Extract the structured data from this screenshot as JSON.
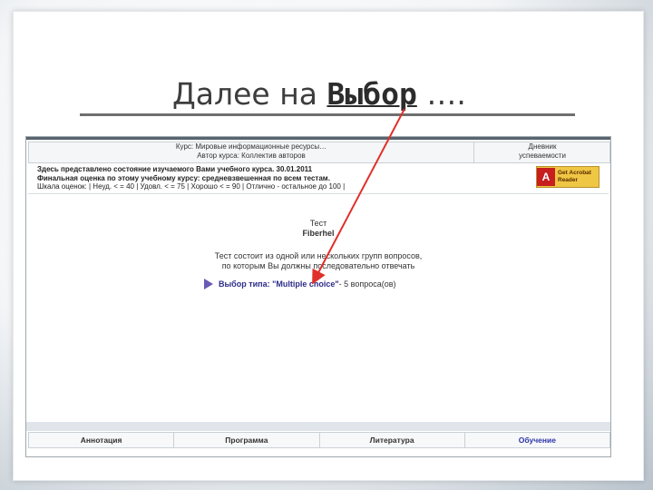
{
  "slide": {
    "title_plain": "Далее на ",
    "title_link": "Выбор",
    "title_dots": " ….",
    "arrow_color": "#e0302a"
  },
  "screen": {
    "course_line": "Курс: Мировые информационные ресурсы…",
    "author_line": "Автор курса: Коллектив авторов",
    "diary": [
      "Дневник",
      "успеваемости"
    ],
    "info": [
      "Здесь представлено состояние изучаемого Вами учебного курса. 30.01.2011",
      "Финальная оценка по этому учебному курсу: средневзвешенная по всем тестам.",
      "Шкала оценок: | Неуд. < = 40 | Удовл. < = 75 | Хорошо < = 90 | Отлично - остальное до 100 |"
    ],
    "acrobat": {
      "logo": "A",
      "line1": "Get Acrobat",
      "line2": "Reader",
      "sub": "Adobe"
    },
    "test_label": "Тест",
    "test_name": "Fiberhel",
    "desc": [
      "Тест состоит из одной или нескольких групп вопросов,",
      "по которым Вы должны последовательно отвечать"
    ],
    "choice_link": "Выбор типа: \"Multiple choice\"",
    "choice_rest": " - 5 вопроса(ов)",
    "nav": [
      "Аннотация",
      "Программа",
      "Литература",
      "Обучение"
    ]
  }
}
